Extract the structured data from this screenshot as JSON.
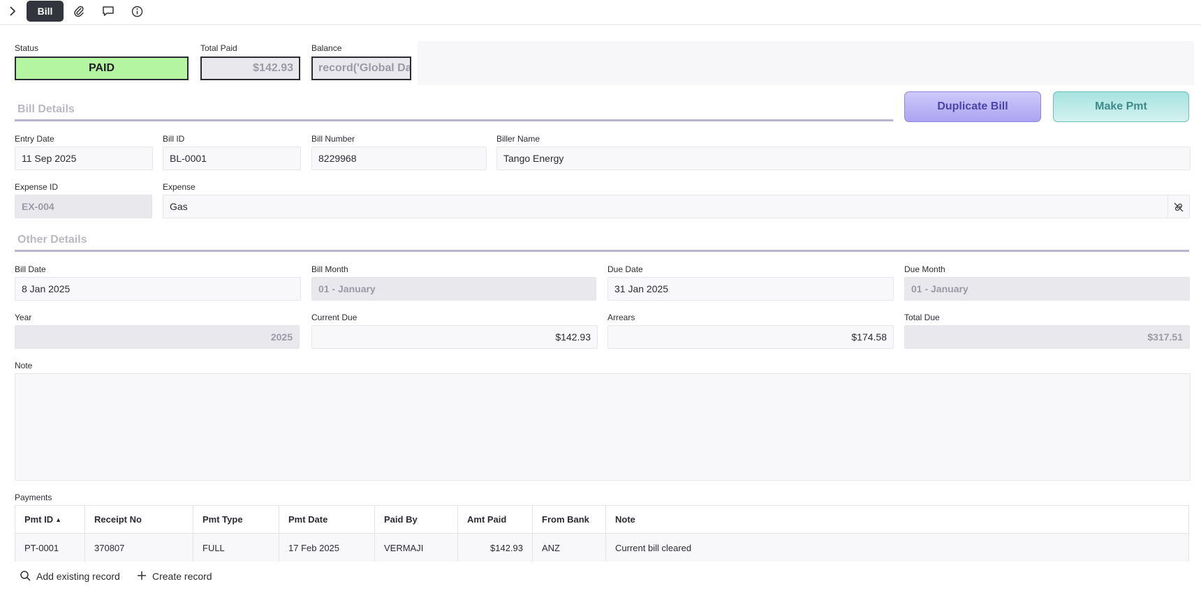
{
  "topbar": {
    "tab_label": "Bill",
    "icons": [
      "chevron-right-icon",
      "paperclip-icon",
      "comment-icon",
      "info-icon"
    ]
  },
  "summary": {
    "status_label": "Status",
    "status_value": "PAID",
    "status_color": "#b3f5a1",
    "total_paid_label": "Total Paid",
    "total_paid_value": "$142.93",
    "balance_label": "Balance",
    "balance_value": "record('Global Data"
  },
  "bill_details": {
    "title": "Bill Details",
    "duplicate_button": "Duplicate Bill",
    "make_payment_button": "Make Pmt",
    "entry_date_label": "Entry Date",
    "entry_date_value": "11 Sep 2025",
    "bill_id_label": "Bill ID",
    "bill_id_value": "BL-0001",
    "bill_number_label": "Bill Number",
    "bill_number_value": "8229968",
    "biller_name_label": "Biller Name",
    "biller_name_value": "Tango Energy",
    "expense_id_label": "Expense ID",
    "expense_id_value": "EX-004",
    "expense_label": "Expense",
    "expense_value": "Gas"
  },
  "other_details": {
    "title": "Other Details",
    "bill_date_label": "Bill Date",
    "bill_date_value": "8 Jan 2025",
    "bill_month_label": "Bill Month",
    "bill_month_value": "01 - January",
    "due_date_label": "Due Date",
    "due_date_value": "31 Jan 2025",
    "due_month_label": "Due Month",
    "due_month_value": "01 - January",
    "year_label": "Year",
    "year_value": "2025",
    "current_due_label": "Current Due",
    "current_due_value": "$142.93",
    "arrears_label": "Arrears",
    "arrears_value": "$174.58",
    "total_due_label": "Total Due",
    "total_due_value": "$317.51",
    "note_label": "Note",
    "note_value": ""
  },
  "payments": {
    "label": "Payments",
    "columns": [
      "Pmt ID",
      "Receipt No",
      "Pmt Type",
      "Pmt Date",
      "Paid By",
      "Amt Paid",
      "From Bank",
      "Note"
    ],
    "sort_indicator": "▲",
    "rows": [
      [
        "PT-0001",
        "370807",
        "FULL",
        "17 Feb 2025",
        "VERMAJI",
        "$142.93",
        "ANZ",
        "Current bill cleared"
      ]
    ],
    "add_existing_label": "Add existing record",
    "create_label": "Create record"
  }
}
